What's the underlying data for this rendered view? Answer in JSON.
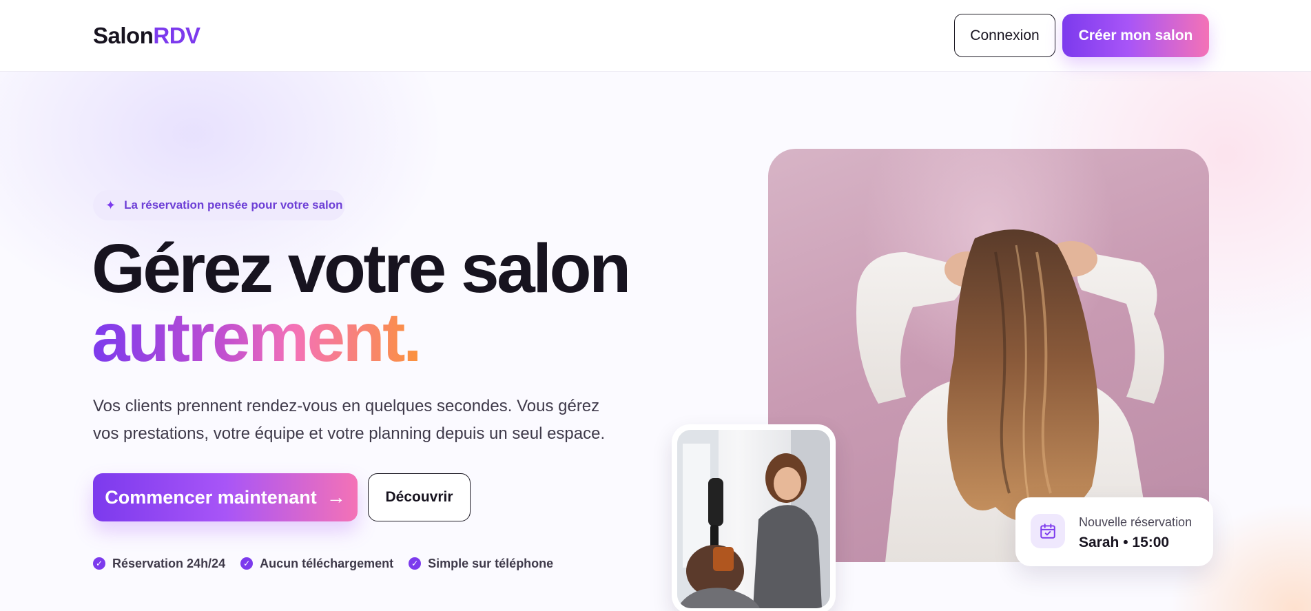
{
  "header": {
    "logo_prefix": "Salon",
    "logo_accent": "RDV",
    "login_label": "Connexion",
    "create_label": "Créer mon salon"
  },
  "hero": {
    "badge": "La réservation pensée pour votre salon",
    "title_line1": "Gérez votre salon",
    "title_line2": "autrement.",
    "lead": "Vos clients prennent rendez-vous en quelques secondes. Vous gérez vos prestations, votre équipe et votre planning depuis un seul espace.",
    "cta_primary": "Commencer maintenant",
    "cta_secondary": "Découvrir",
    "features": [
      "Réservation 24h/24",
      "Aucun téléchargement",
      "Simple sur téléphone"
    ]
  },
  "notification": {
    "title": "Nouvelle réservation",
    "value": "Sarah • 15:00"
  },
  "icons": {
    "badge": "sparkles-icon",
    "cta_arrow": "arrow-right-icon",
    "feature": "check-circle-icon",
    "notification": "calendar-check-icon"
  },
  "colors": {
    "accent": "#7c3aed",
    "gradient_start": "#7c3aed",
    "gradient_mid": "#f472b6",
    "gradient_end": "#fb923c",
    "text": "#17131f"
  }
}
